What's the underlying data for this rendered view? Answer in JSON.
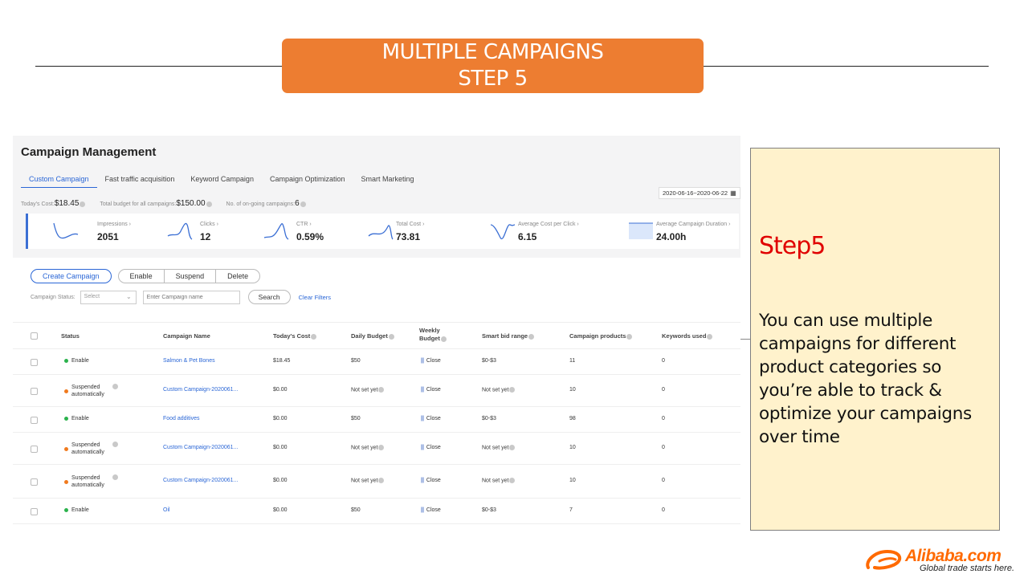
{
  "banner": {
    "line1": "MULTIPLE CAMPAIGNS",
    "line2": "STEP 5"
  },
  "panel": {
    "title": "Campaign Management",
    "tabs": [
      {
        "label": "Custom Campaign",
        "active": true
      },
      {
        "label": "Fast traffic acquisition",
        "active": false
      },
      {
        "label": "Keyword Campaign",
        "active": false
      },
      {
        "label": "Campaign Optimization",
        "active": false
      },
      {
        "label": "Smart Marketing",
        "active": false
      }
    ],
    "date_range": "2020-06-16~2020-06-22",
    "summary": {
      "today_cost_label": "Today's Cost:",
      "today_cost_value": "$18.45",
      "total_budget_label": "Total budget for all campaigns:",
      "total_budget_value": "$150.00",
      "ongoing_label": "No. of on-going campaigns:",
      "ongoing_value": "6"
    },
    "metrics": [
      {
        "label": "Impressions",
        "value": "2051"
      },
      {
        "label": "Clicks",
        "value": "12"
      },
      {
        "label": "CTR",
        "value": "0.59%"
      },
      {
        "label": "Total Cost",
        "value": "73.81"
      },
      {
        "label": "Average Cost per Click",
        "value": "6.15"
      },
      {
        "label": "Average Campaign Duration",
        "value": "24.00h"
      }
    ],
    "buttons": {
      "create": "Create Campaign",
      "enable": "Enable",
      "suspend": "Suspend",
      "delete": "Delete"
    },
    "filters": {
      "status_label": "Campaign Status:",
      "select_value": "Select",
      "name_placeholder": "Enter Campaign name",
      "search": "Search",
      "clear": "Clear Filters"
    },
    "table": {
      "headers": {
        "status": "Status",
        "name": "Campaign Name",
        "today_cost": "Today's Cost",
        "daily_budget": "Daily Budget",
        "weekly_budget_1": "Weekly",
        "weekly_budget_2": "Budget",
        "smart_bid": "Smart bid range",
        "products": "Campaign products",
        "keywords": "Keywords used"
      },
      "rows": [
        {
          "status_1": "Enable",
          "status_2": "",
          "status_color": "green",
          "name": "Salmon & Pet Bones",
          "today_cost": "$18.45",
          "daily_budget": "$50",
          "weekly": "Close",
          "smart_bid": "$0-$3",
          "products": "11",
          "keywords": "0"
        },
        {
          "status_1": "Suspended",
          "status_2": "automatically",
          "status_color": "orange",
          "name": "Custom Campaign-2020061...",
          "today_cost": "$0.00",
          "daily_budget": "Not set yet",
          "weekly": "Close",
          "smart_bid": "Not set yet",
          "products": "10",
          "keywords": "0"
        },
        {
          "status_1": "Enable",
          "status_2": "",
          "status_color": "green",
          "name": "Food additives",
          "today_cost": "$0.00",
          "daily_budget": "$50",
          "weekly": "Close",
          "smart_bid": "$0-$3",
          "products": "98",
          "keywords": "0"
        },
        {
          "status_1": "Suspended",
          "status_2": "automatically",
          "status_color": "orange",
          "name": "Custom Campaign-2020061...",
          "today_cost": "$0.00",
          "daily_budget": "Not set yet",
          "weekly": "Close",
          "smart_bid": "Not set yet",
          "products": "10",
          "keywords": "0"
        },
        {
          "status_1": "Suspended",
          "status_2": "automatically",
          "status_color": "orange",
          "name": "Custom Campaign-2020061...",
          "today_cost": "$0.00",
          "daily_budget": "Not set yet",
          "weekly": "Close",
          "smart_bid": "Not set yet",
          "products": "10",
          "keywords": "0"
        },
        {
          "status_1": "Enable",
          "status_2": "",
          "status_color": "green",
          "name": "Oil",
          "today_cost": "$0.00",
          "daily_budget": "$50",
          "weekly": "Close",
          "smart_bid": "$0-$3",
          "products": "7",
          "keywords": "0"
        }
      ]
    }
  },
  "note": {
    "title": "Step5",
    "text": "You can use multiple campaigns for different product categories so you’re able to track & optimize your campaigns over time"
  },
  "logo": {
    "brand": "Alibaba.com",
    "tagline": "Global trade starts here."
  },
  "colors": {
    "banner": "#ed7d31",
    "note_bg": "#fff2cc",
    "note_title": "#e00000",
    "link": "#2a66d6",
    "enable": "#2bb24c",
    "suspended": "#f07a1e",
    "brand": "#ff6a00"
  }
}
